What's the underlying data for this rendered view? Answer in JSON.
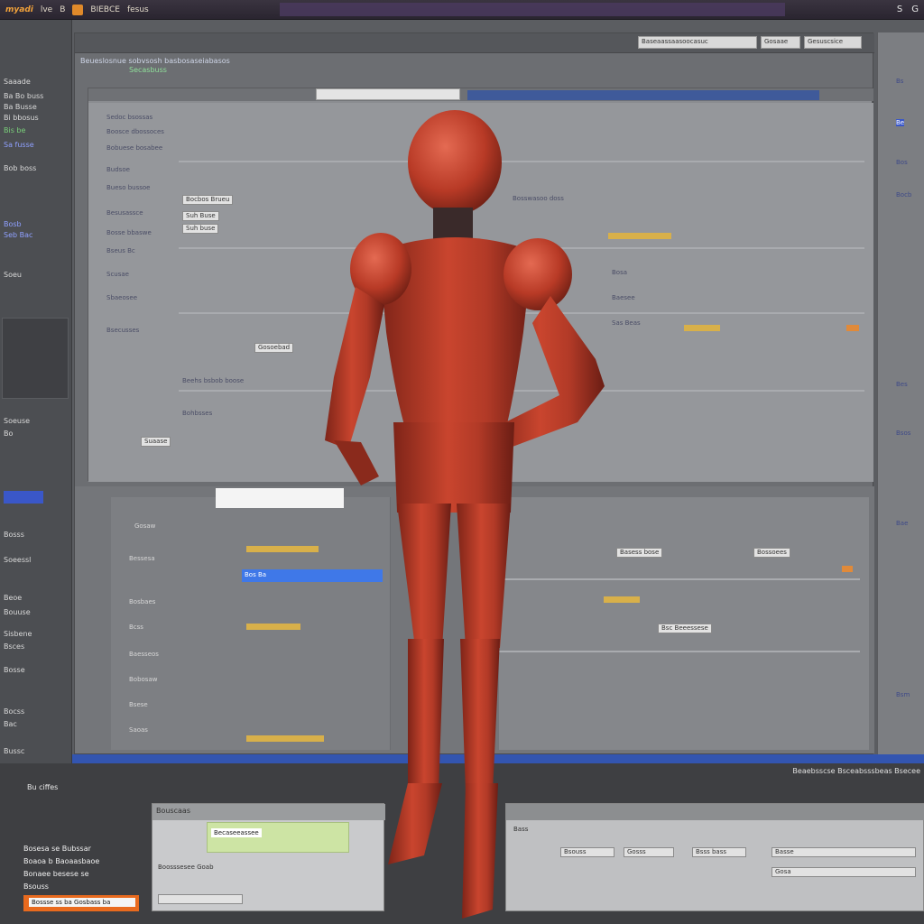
{
  "topbar": {
    "brand": "myadi",
    "menu_1": "lve",
    "menu_2": "B",
    "menu_3": "BIEBCE",
    "menu_4": "fesus",
    "right_1": "S",
    "right_2": "G"
  },
  "main": {
    "toolbar_fields": [
      "Baseaassaasoocasuc",
      "Gosaae",
      "Gesuscsice"
    ],
    "breadcrumb": "Beueslosnue sobvsosh basbosaseiabasos",
    "status": "Secasbuss"
  },
  "left_rail": {
    "items": [
      "Saaade",
      "Ba Bo buss",
      "Ba Busse",
      "Bi bbosus",
      "Sa fusse",
      "Bob boss",
      "Bosb",
      "Seb Bac",
      "Soeu",
      "Soeuse",
      "Bo",
      "Bosss",
      "Soeessl",
      "Beoe",
      "Bouuse",
      "Sisbene",
      "Bsces",
      "Bosse",
      "Bocss",
      "Bac",
      "Bussc"
    ],
    "green_item": "Bis be"
  },
  "upper_panel": {
    "buttons": [
      "Bocbos Brueu",
      "Suh Buse",
      "Suh buse",
      "Gosoebad",
      "Suaase"
    ],
    "rows": [
      "Sedoc bsossas",
      "Boosce dbossoces",
      "Bobuese bosabee",
      "Budsoe",
      "Bueso bussoe",
      "Besusassce",
      "Bosse bbaswe",
      "Bseus Bc",
      "Scusae",
      "Sbaeosee",
      "Bsecusses",
      "Beehs bsbob boose",
      "Bohbsses"
    ],
    "right_rows": [
      "Bosswasoo doss",
      "Bosa",
      "Baesee",
      "Sas Beas"
    ]
  },
  "lower_panel": {
    "items": [
      "Gosaw",
      "Bessesa",
      "Bosbaes",
      "Bcss",
      "Baesseos",
      "Bobosaw",
      "Bsese",
      "Saoas",
      "Bsemo"
    ],
    "selected": "Bos Ba",
    "right_buttons": [
      "Basess bose",
      "Bossoees",
      "Bsc Beeessese"
    ]
  },
  "right_rail": {
    "items": [
      "Bs",
      "Be",
      "Bos",
      "Bocb",
      "Bes",
      "Bsos",
      "Bae",
      "Bsm"
    ]
  },
  "bottom": {
    "status": "Beaebsscse Bsceabsssbeas Bsecee",
    "list": [
      "Bosesa se Bubssar",
      "Boaoa b Baoaasbaoe",
      "Bonaee besese se",
      "Bsouss"
    ],
    "header_left": "Bu ciffes",
    "dialog_left_title": "Bouscaas",
    "dialog_left_field": "Becaseeassee",
    "dialog_left_text": "Boosssesee Goab",
    "orange_field": "Bossse ss ba Gosbass ba",
    "dialog_right_labels": [
      "Bass",
      "Bsouss",
      "Gosss",
      "Bsss bass",
      "Basse",
      "Gosa"
    ]
  }
}
